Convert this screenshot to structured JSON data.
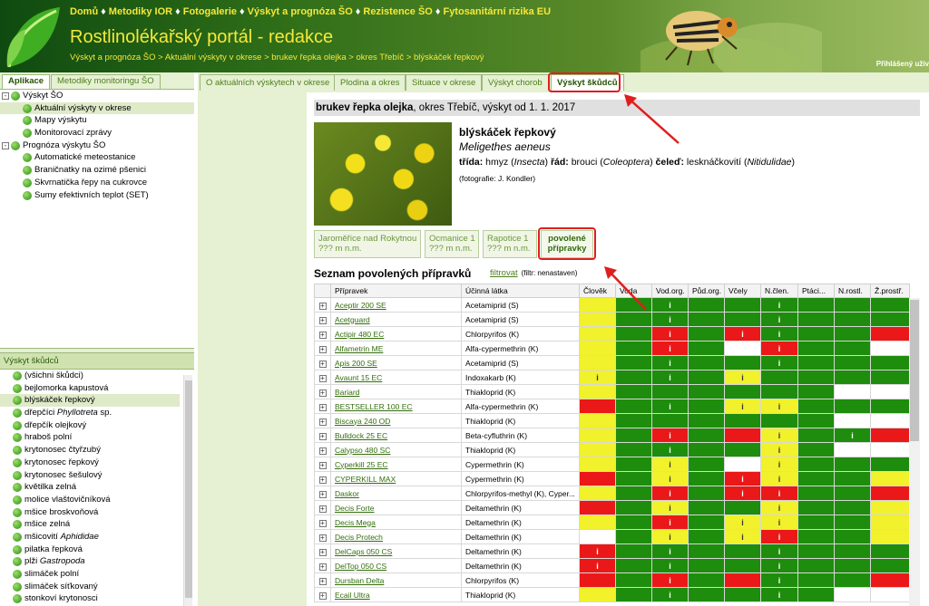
{
  "header": {
    "nav": [
      "Domů",
      "Metodiky IOR",
      "Fotogalerie",
      "Výskyt a prognóza ŠO",
      "Rezistence ŠO",
      "Fytosanitární rizika EU"
    ],
    "nav_sep": "♦",
    "title": "Rostlinolékařský portál - redakce",
    "breadcrumb": "Výskyt a prognóza ŠO > Aktuální výskyty v okrese > brukev řepka olejka > okres Třebíč > blýskáček řepkový",
    "login": "Přihlášený uživ"
  },
  "left_tabs": [
    "Aplikace",
    "Metodiky monitoringu ŠO"
  ],
  "tree": [
    {
      "label": "Výskyt ŠO",
      "level": 0,
      "toggle": "-",
      "selected": false
    },
    {
      "label": "Aktuální výskyty v okrese",
      "level": 1,
      "selected": true
    },
    {
      "label": "Mapy výskytu",
      "level": 1,
      "selected": false
    },
    {
      "label": "Monitorovací zprávy",
      "level": 1,
      "selected": false
    },
    {
      "label": "Prognóza výskytu ŠO",
      "level": 0,
      "toggle": "-",
      "selected": false
    },
    {
      "label": "Automatické meteostanice",
      "level": 1,
      "selected": false
    },
    {
      "label": "Braničnatky na ozimé pšenici",
      "level": 1,
      "selected": false
    },
    {
      "label": "Skvrnatička řepy na cukrovce",
      "level": 1,
      "selected": false
    },
    {
      "label": "Sumy efektivních teplot (SET)",
      "level": 1,
      "selected": false
    }
  ],
  "pests_panel": {
    "header": "Výskyt škůdců",
    "items": [
      {
        "label": "(všichni škůdci)"
      },
      {
        "label": "bejlomorka kapustová"
      },
      {
        "label": "blýskáček řepkový",
        "selected": true
      },
      {
        "label": "dřepčíci ",
        "italic": "Phyllotreta",
        "suffix": " sp."
      },
      {
        "label": "dřepčík olejkový"
      },
      {
        "label": "hraboš polní"
      },
      {
        "label": "krytonosec čtyřzubý"
      },
      {
        "label": "krytonosec řepkový"
      },
      {
        "label": "krytonosec šešulový"
      },
      {
        "label": "květilka zelná"
      },
      {
        "label": "molice vlaštovičníková"
      },
      {
        "label": "mšice broskvoňová"
      },
      {
        "label": "mšice zelná"
      },
      {
        "label": "mšicovití ",
        "italic": "Aphididae"
      },
      {
        "label": "pilatka řepková"
      },
      {
        "label": "plži ",
        "italic": "Gastropoda"
      },
      {
        "label": "slimáček polní"
      },
      {
        "label": "slimáček síťkovaný"
      },
      {
        "label": "stonkoví krytonosci"
      }
    ]
  },
  "main_tabs": [
    "O aktuálních výskytech v okrese",
    "Plodina a okres",
    "Situace v okrese",
    "Výskyt chorob",
    "Výskyt škůdců"
  ],
  "crop_header": {
    "bold": "brukev řepka olejka",
    "rest": ", okres Třebíč, výskyt od 1. 1. 2017"
  },
  "pest": {
    "name": "blýskáček řepkový",
    "latin": "Meligethes aeneus",
    "tax": [
      {
        "k": "třída:",
        "v": " hmyz (",
        "i": "Insecta",
        "e": ") "
      },
      {
        "k": "řád:",
        "v": " brouci (",
        "i": "Coleoptera",
        "e": ") "
      },
      {
        "k": "čeleď:",
        "v": " lesknáčkovití (",
        "i": "Nitidulidae",
        "e": ")"
      }
    ],
    "photo_credit": "(fotografie: J. Kondler)"
  },
  "sub_tabs": [
    {
      "line1": "Jaroměřice nad Rokytnou",
      "line2": "??? m n.m."
    },
    {
      "line1": "Ocmanice 1",
      "line2": "??? m n.m."
    },
    {
      "line1": "Rapotice 1",
      "line2": "??? m n.m."
    },
    {
      "line1": "povolené",
      "line2": "přípravky"
    }
  ],
  "list": {
    "title": "Seznam povolených přípravků",
    "filter_link": "filtrovat",
    "filter_hint": "(filtr: nenastaven)",
    "columns": [
      "Přípravek",
      "Účinná látka",
      "Člověk",
      "Voda",
      "Vod.org.",
      "Půd.org.",
      "Včely",
      "N.člen.",
      "Ptáci...",
      "N.rostl.",
      "Ž.prostř."
    ],
    "rows": [
      {
        "name": "Aceptir 200 SE",
        "substance": "Acetamiprid (S)",
        "cells": [
          "Y",
          "G",
          "Gi",
          "G",
          "G",
          "Gi",
          "G",
          "G",
          "G"
        ]
      },
      {
        "name": "Acetguard",
        "substance": "Acetamiprid (S)",
        "cells": [
          "Y",
          "G",
          "Gi",
          "G",
          "G",
          "Gi",
          "G",
          "G",
          "G"
        ]
      },
      {
        "name": "Actipir 480 EC",
        "substance": "Chlorpyrifos (K)",
        "cells": [
          "Y",
          "G",
          "Ri",
          "G",
          "Ri",
          "Gi",
          "G",
          "G",
          "R"
        ]
      },
      {
        "name": "Alfametrin ME",
        "substance": "Alfa-cypermethrin (K)",
        "cells": [
          "Y",
          "G",
          "Ri",
          "G",
          "W",
          "Ri",
          "G",
          "G",
          "W"
        ]
      },
      {
        "name": "Apis 200 SE",
        "substance": "Acetamiprid (S)",
        "cells": [
          "Y",
          "G",
          "Gi",
          "G",
          "G",
          "Gi",
          "G",
          "G",
          "G"
        ]
      },
      {
        "name": "Avaunt 15 EC",
        "substance": "Indoxakarb (K)",
        "cells": [
          "Yi",
          "G",
          "Gi",
          "G",
          "Yi",
          "G",
          "G",
          "G",
          "G"
        ]
      },
      {
        "name": "Bariard",
        "substance": "Thiakloprid (K)",
        "cells": [
          "Y",
          "G",
          "G",
          "G",
          "G",
          "G",
          "G",
          "W",
          "W"
        ]
      },
      {
        "name": "BESTSELLER 100 EC",
        "substance": "Alfa-cypermethrin (K)",
        "cells": [
          "R",
          "G",
          "Gi",
          "G",
          "Yi",
          "Yi",
          "G",
          "G",
          "G"
        ]
      },
      {
        "name": "Biscaya 240 OD",
        "substance": "Thiakloprid (K)",
        "cells": [
          "Y",
          "G",
          "G",
          "G",
          "G",
          "G",
          "G",
          "W",
          "W"
        ]
      },
      {
        "name": "Bulldock 25 EC",
        "substance": "Beta-cyfluthrin (K)",
        "cells": [
          "Y",
          "G",
          "Ri",
          "G",
          "R",
          "Yi",
          "G",
          "Gi",
          "R"
        ]
      },
      {
        "name": "Calypso 480 SC",
        "substance": "Thiakloprid (K)",
        "cells": [
          "Y",
          "G",
          "Gi",
          "G",
          "G",
          "Yi",
          "G",
          "W",
          "W"
        ]
      },
      {
        "name": "Cyperkill 25 EC",
        "substance": "Cypermethrin (K)",
        "cells": [
          "Y",
          "G",
          "Yi",
          "G",
          "W",
          "Yi",
          "G",
          "G",
          "G"
        ]
      },
      {
        "name": "CYPERKILL MAX",
        "substance": "Cypermethrin (K)",
        "cells": [
          "R",
          "G",
          "Yi",
          "G",
          "Ri",
          "Yi",
          "G",
          "G",
          "Y"
        ]
      },
      {
        "name": "Daskor",
        "substance": "Chlorpyrifos-methyl (K), Cyper...",
        "cells": [
          "Y",
          "G",
          "Ri",
          "G",
          "Ri",
          "Ri",
          "G",
          "G",
          "R"
        ]
      },
      {
        "name": "Decis Forte",
        "substance": "Deltamethrin (K)",
        "cells": [
          "R",
          "G",
          "Yi",
          "G",
          "G",
          "Yi",
          "G",
          "G",
          "Y"
        ]
      },
      {
        "name": "Decis Mega",
        "substance": "Deltamethrin (K)",
        "cells": [
          "Y",
          "G",
          "Ri",
          "G",
          "Yi",
          "Yi",
          "G",
          "G",
          "Y"
        ]
      },
      {
        "name": "Decis Protech",
        "substance": "Deltamethrin (K)",
        "cells": [
          "W",
          "G",
          "Yi",
          "G",
          "Yi",
          "Ri",
          "G",
          "G",
          "Y"
        ]
      },
      {
        "name": "DelCaps 050 CS",
        "substance": "Deltamethrin (K)",
        "cells": [
          "Ri",
          "G",
          "Gi",
          "G",
          "G",
          "Gi",
          "G",
          "G",
          "G"
        ]
      },
      {
        "name": "DelTop 050 CS",
        "substance": "Deltamethrin (K)",
        "cells": [
          "Ri",
          "G",
          "Gi",
          "G",
          "G",
          "Gi",
          "G",
          "G",
          "G"
        ]
      },
      {
        "name": "Dursban Delta",
        "substance": "Chlorpyrifos (K)",
        "cells": [
          "R",
          "G",
          "Ri",
          "G",
          "R",
          "Gi",
          "G",
          "G",
          "R"
        ]
      },
      {
        "name": "Ecail Ultra",
        "substance": "Thiakloprid (K)",
        "cells": [
          "Y",
          "G",
          "Gi",
          "G",
          "G",
          "Gi",
          "G",
          "W",
          "W"
        ]
      }
    ]
  },
  "colors": {
    "green": "#1e8c0c",
    "yellow": "#f1f12c",
    "red": "#ea1818",
    "annotation": "#e01e1e"
  }
}
